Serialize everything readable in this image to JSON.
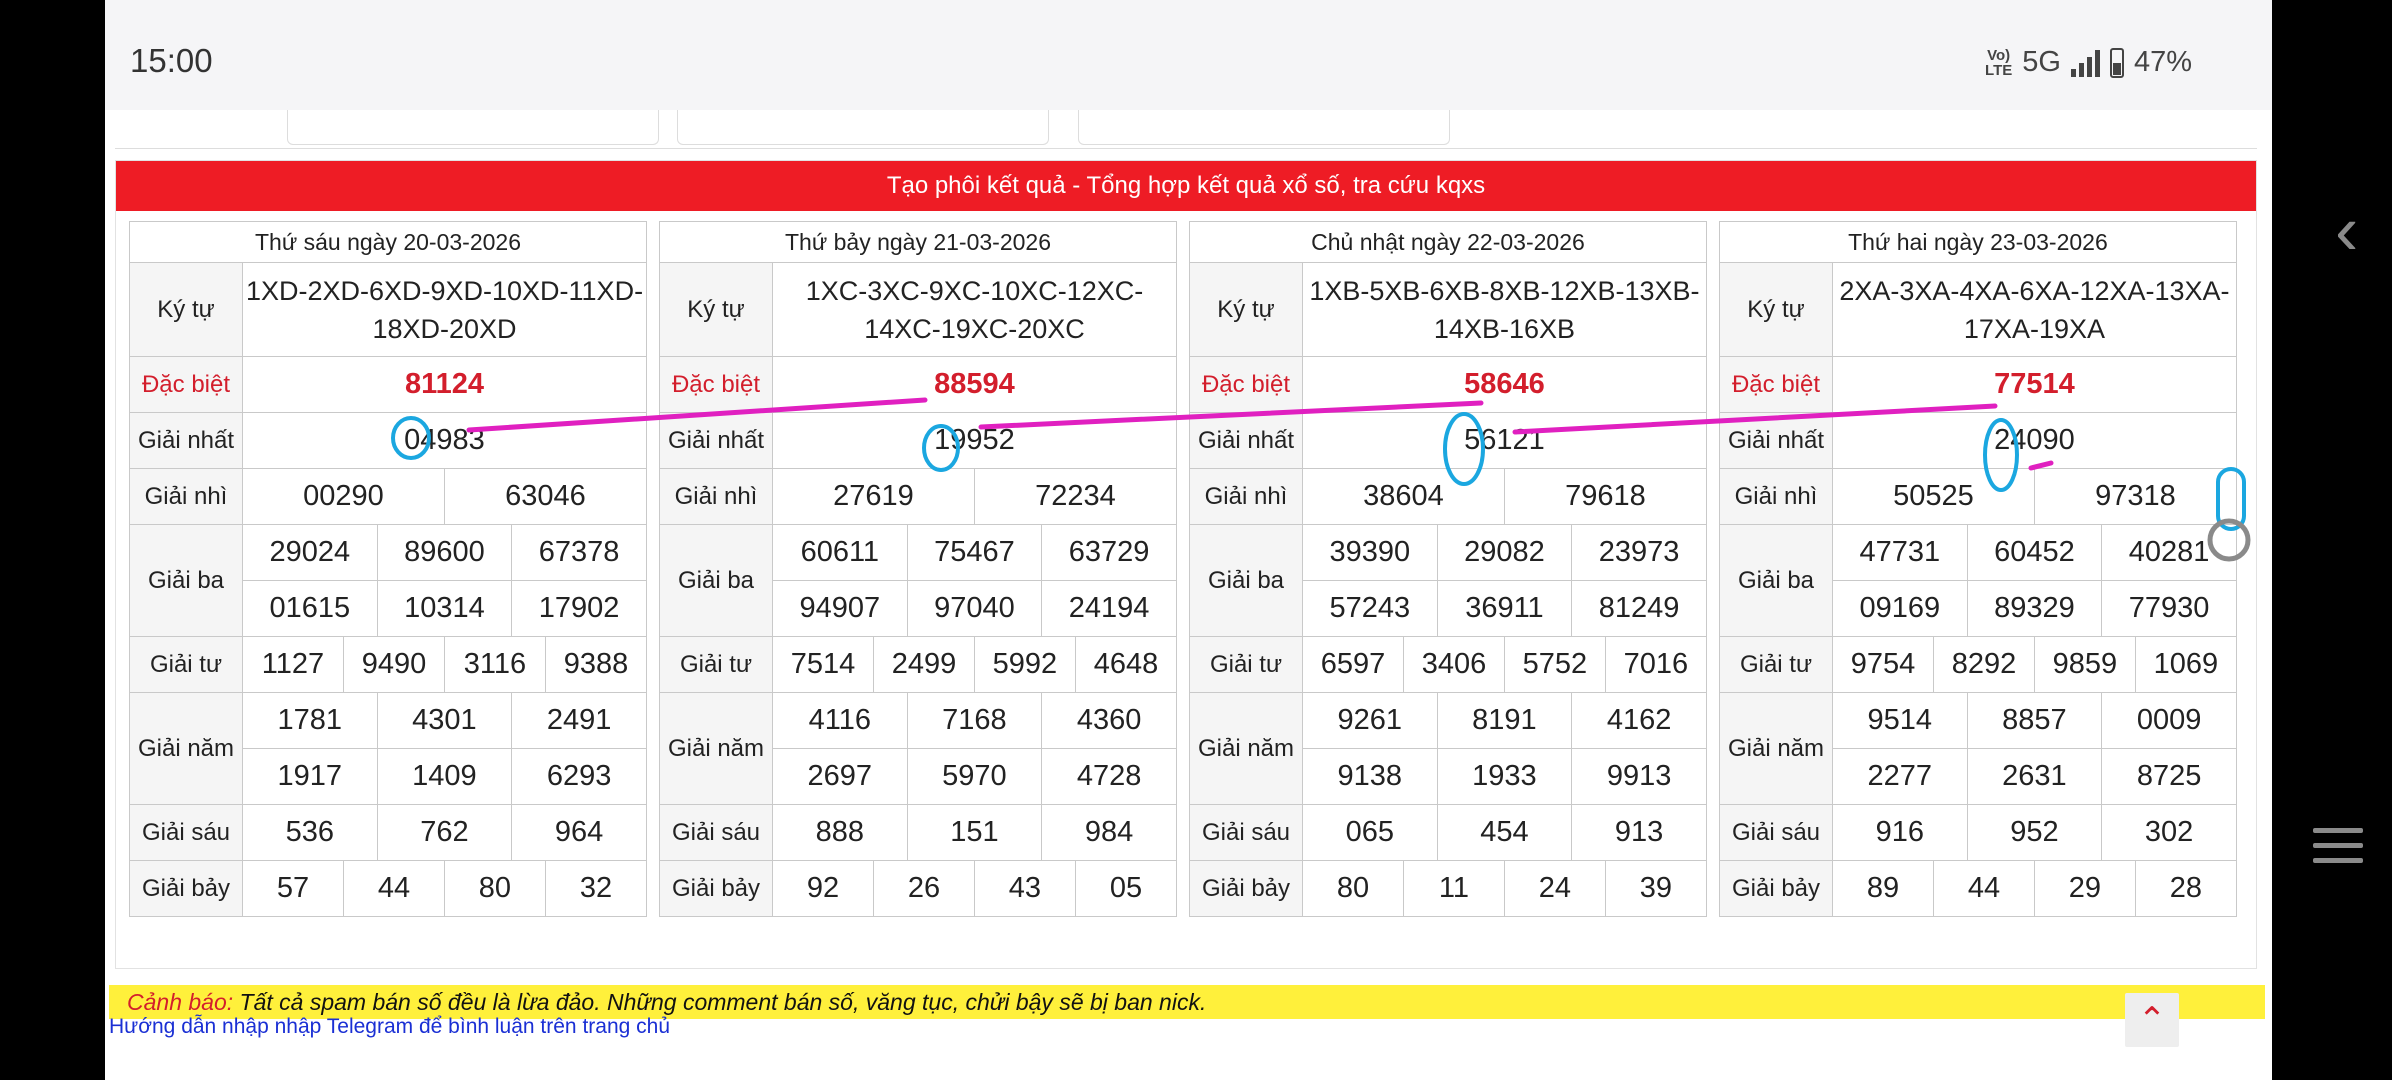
{
  "status_bar": {
    "time": "15:00",
    "volte_top": "Vo)",
    "volte_bottom": "LTE",
    "network": "5G",
    "battery": "47%"
  },
  "banner": "Tạo phôi kết quả - Tổng hợp kết quả xổ số, tra cứu kqxs",
  "labels": {
    "kytu": "Ký tự",
    "db": "Đặc biệt",
    "g1": "Giải nhất",
    "g2": "Giải nhì",
    "g3": "Giải ba",
    "g4": "Giải tư",
    "g5": "Giải năm",
    "g6": "Giải sáu",
    "g7": "Giải bảy"
  },
  "days": [
    {
      "date": "Thứ sáu ngày 20-03-2026",
      "kytu": "1XD-2XD-6XD-9XD-10XD-11XD-18XD-20XD",
      "db": "81124",
      "g1": "04983",
      "g2": [
        "00290",
        "63046"
      ],
      "g3": [
        "29024",
        "89600",
        "67378",
        "01615",
        "10314",
        "17902"
      ],
      "g4": [
        "1127",
        "9490",
        "3116",
        "9388"
      ],
      "g5": [
        "1781",
        "4301",
        "2491",
        "1917",
        "1409",
        "6293"
      ],
      "g6": [
        "536",
        "762",
        "964"
      ],
      "g7": [
        "57",
        "44",
        "80",
        "32"
      ]
    },
    {
      "date": "Thứ bảy ngày 21-03-2026",
      "kytu": "1XC-3XC-9XC-10XC-12XC-14XC-19XC-20XC",
      "db": "88594",
      "g1": "19952",
      "g2": [
        "27619",
        "72234"
      ],
      "g3": [
        "60611",
        "75467",
        "63729",
        "94907",
        "97040",
        "24194"
      ],
      "g4": [
        "7514",
        "2499",
        "5992",
        "4648"
      ],
      "g5": [
        "4116",
        "7168",
        "4360",
        "2697",
        "5970",
        "4728"
      ],
      "g6": [
        "888",
        "151",
        "984"
      ],
      "g7": [
        "92",
        "26",
        "43",
        "05"
      ]
    },
    {
      "date": "Chủ nhật ngày 22-03-2026",
      "kytu": "1XB-5XB-6XB-8XB-12XB-13XB-14XB-16XB",
      "db": "58646",
      "g1": "56121",
      "g2": [
        "38604",
        "79618"
      ],
      "g3": [
        "39390",
        "29082",
        "23973",
        "57243",
        "36911",
        "81249"
      ],
      "g4": [
        "6597",
        "3406",
        "5752",
        "7016"
      ],
      "g5": [
        "9261",
        "8191",
        "4162",
        "9138",
        "1933",
        "9913"
      ],
      "g6": [
        "065",
        "454",
        "913"
      ],
      "g7": [
        "80",
        "11",
        "24",
        "39"
      ]
    },
    {
      "date": "Thứ hai ngày 23-03-2026",
      "kytu": "2XA-3XA-4XA-6XA-12XA-13XA-17XA-19XA",
      "db": "77514",
      "g1": "24090",
      "g2": [
        "50525",
        "97318"
      ],
      "g3": [
        "47731",
        "60452",
        "40281",
        "09169",
        "89329",
        "77930"
      ],
      "g4": [
        "9754",
        "8292",
        "9859",
        "1069"
      ],
      "g5": [
        "9514",
        "8857",
        "0009",
        "2277",
        "2631",
        "8725"
      ],
      "g6": [
        "916",
        "952",
        "302"
      ],
      "g7": [
        "89",
        "44",
        "29",
        "28"
      ]
    }
  ],
  "warning": {
    "label": "Cảnh báo:",
    "text": " Tất cả spam bán số đều là lừa đảo. Những comment bán số, văng tục, chửi bậy sẽ bị ban nick."
  },
  "telegram_link": "Hướng dẫn nhập nhập Telegram để bình luận trên trang chủ",
  "icons": {
    "back": "chevron-left-icon",
    "menu": "hamburger-icon",
    "to_top": "chevron-up-icon"
  },
  "colors": {
    "banner": "#ee1c25",
    "red_text": "#d31e2c",
    "warning_bg": "#fff03b",
    "marker": "#e020c0",
    "circle": "#1ba7e0"
  }
}
